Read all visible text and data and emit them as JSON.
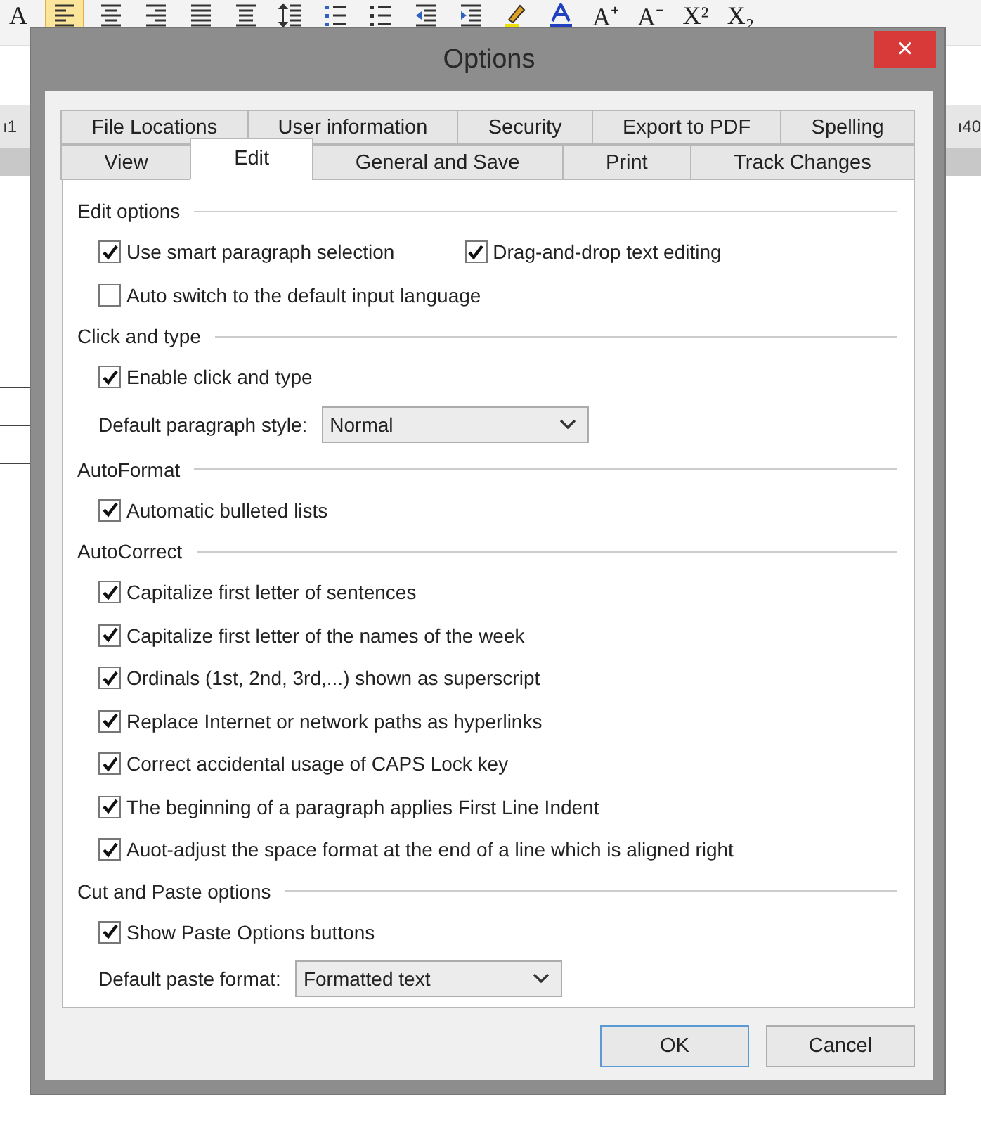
{
  "toolbar": {
    "items": [
      {
        "kind": "glyph",
        "text": "A",
        "selected": false
      },
      {
        "kind": "align-left",
        "selected": true
      },
      {
        "kind": "align-center",
        "selected": false
      },
      {
        "kind": "align-right",
        "selected": false
      },
      {
        "kind": "justify",
        "selected": false
      },
      {
        "kind": "distribute",
        "selected": false
      },
      {
        "kind": "line-spacing",
        "selected": false
      },
      {
        "kind": "numbered-list",
        "selected": false
      },
      {
        "kind": "bullet-list",
        "selected": false
      },
      {
        "kind": "outdent",
        "selected": false
      },
      {
        "kind": "indent",
        "selected": false
      },
      {
        "kind": "highlighter",
        "selected": false
      },
      {
        "kind": "font-color",
        "selected": false
      },
      {
        "kind": "glyph",
        "text": "A⁺",
        "selected": false
      },
      {
        "kind": "glyph",
        "text": "A⁻",
        "selected": false
      },
      {
        "kind": "glyph",
        "text": "X²",
        "selected": false
      },
      {
        "kind": "glyph",
        "text": "X₂",
        "selected": false
      }
    ]
  },
  "ruler": {
    "left_label": "ı1",
    "right_label": "ı40"
  },
  "window": {
    "title": "Options",
    "close": "×"
  },
  "tabs": [
    [
      {
        "label": "File Locations",
        "selected": false
      },
      {
        "label": "User information",
        "selected": false
      },
      {
        "label": "Security",
        "selected": false
      },
      {
        "label": "Export to PDF",
        "selected": false
      },
      {
        "label": "Spelling",
        "selected": false
      }
    ],
    [
      {
        "label": "View",
        "selected": false
      },
      {
        "label": "Edit",
        "selected": true
      },
      {
        "label": "General and Save",
        "selected": false
      },
      {
        "label": "Print",
        "selected": false
      },
      {
        "label": "Track Changes",
        "selected": false
      }
    ]
  ],
  "sections": [
    {
      "title": "Edit options",
      "rows": [
        {
          "kind": "checkboxes",
          "items": [
            {
              "label": "Use smart paragraph selection",
              "checked": true
            },
            {
              "label": "Drag-and-drop text editing",
              "checked": true
            }
          ]
        },
        {
          "kind": "checkboxes",
          "items": [
            {
              "label": "Auto switch to the default input language",
              "checked": false
            }
          ]
        }
      ]
    },
    {
      "title": "Click and type",
      "rows": [
        {
          "kind": "checkboxes",
          "items": [
            {
              "label": "Enable click and type",
              "checked": true
            }
          ]
        },
        {
          "kind": "dropdown",
          "label": "Default paragraph style:",
          "value": "Normal"
        }
      ]
    },
    {
      "title": "AutoFormat",
      "rows": [
        {
          "kind": "checkboxes",
          "items": [
            {
              "label": "Automatic bulleted lists",
              "checked": true
            }
          ]
        }
      ]
    },
    {
      "title": "AutoCorrect",
      "rows": [
        {
          "kind": "checkboxes",
          "items": [
            {
              "label": "Capitalize first letter of sentences",
              "checked": true
            }
          ]
        },
        {
          "kind": "checkboxes",
          "items": [
            {
              "label": "Capitalize first letter of the names of the week",
              "checked": true
            }
          ]
        },
        {
          "kind": "checkboxes",
          "items": [
            {
              "label": "Ordinals (1st, 2nd, 3rd,...) shown as superscript",
              "checked": true
            }
          ]
        },
        {
          "kind": "checkboxes",
          "items": [
            {
              "label": "Replace Internet or network paths as hyperlinks",
              "checked": true
            }
          ]
        },
        {
          "kind": "checkboxes",
          "items": [
            {
              "label": "Correct accidental usage of CAPS Lock key",
              "checked": true
            }
          ]
        },
        {
          "kind": "checkboxes",
          "items": [
            {
              "label": "The beginning of a paragraph applies First Line Indent",
              "checked": true
            }
          ]
        },
        {
          "kind": "checkboxes",
          "items": [
            {
              "label": "Auot-adjust the space format at the end of a line which is aligned right",
              "checked": true
            }
          ]
        }
      ]
    },
    {
      "title": "Cut and Paste options",
      "rows": [
        {
          "kind": "checkboxes",
          "items": [
            {
              "label": "Show Paste Options buttons",
              "checked": true
            }
          ]
        },
        {
          "kind": "dropdown",
          "label": "Default paste format:",
          "value": "Formatted text"
        }
      ]
    }
  ],
  "buttons": [
    {
      "label": "OK",
      "default": true
    },
    {
      "label": "Cancel",
      "default": false
    }
  ]
}
